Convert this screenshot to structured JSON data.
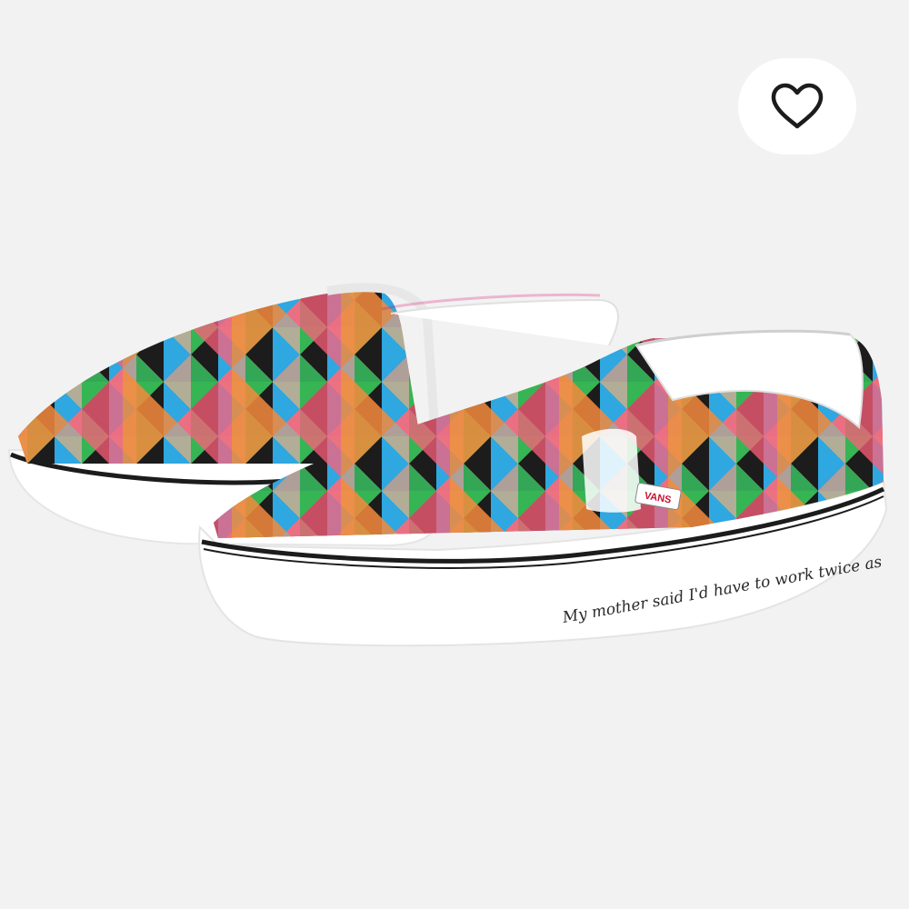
{
  "page": {
    "background": "#f2f2f2"
  },
  "product": {
    "image_alt": "Vans slip-on sneakers with multicolor geometric triangle print",
    "brand_tag": "VANS",
    "sidewall_script": "My mother said I'd have to work twice as",
    "palette": [
      "#f26d6d",
      "#ffd21a",
      "#2fa7e0",
      "#20b25a",
      "#e8413a",
      "#f4a6b8",
      "#1c1c1c",
      "#a9a9a4",
      "#f58a3c",
      "#ff5f7a"
    ]
  },
  "favorite": {
    "icon": "heart-outline-icon",
    "aria_label": "Add to favorites"
  }
}
